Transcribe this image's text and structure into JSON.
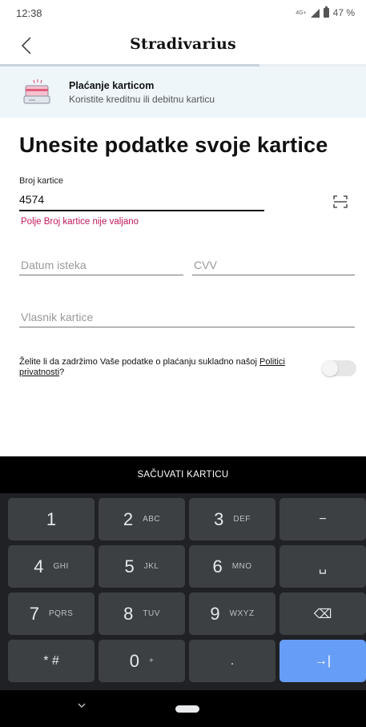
{
  "status_bar": {
    "time": "12:38",
    "network": "4G+",
    "battery": "47 %",
    "icons": [
      "network-type-icon",
      "signal-icon",
      "battery-icon"
    ]
  },
  "header": {
    "brand": "Stradivarius",
    "back_icon": "back-chevron-icon",
    "step_progress": 0.71
  },
  "payment_method": {
    "icon": "credit-card-icon",
    "title": "Plaćanje karticom",
    "subtitle": "Koristite kreditnu ili debitnu karticu"
  },
  "form": {
    "heading": "Unesite podatke svoje kartice",
    "card_number": {
      "label": "Broj kartice",
      "value": "4574",
      "error": "Polje Broj kartice nije valjano",
      "scan_icon": "scan-card-icon"
    },
    "expiry": {
      "placeholder": "Datum isteka",
      "value": ""
    },
    "cvv": {
      "placeholder": "CVV",
      "value": ""
    },
    "holder": {
      "placeholder": "Vlasnik kartice",
      "value": ""
    },
    "save_consent": {
      "text": "Želite li da zadržimo Vaše podatke o plaćanju sukladno našoj ",
      "link": "Politici privatnosti",
      "suffix": "?",
      "toggle_on": false
    }
  },
  "save_button": "SAČUVATI KARTICU",
  "keyboard": {
    "keys": [
      {
        "main": "1",
        "sub": ""
      },
      {
        "main": "2",
        "sub": "ABC"
      },
      {
        "main": "3",
        "sub": "DEF"
      },
      {
        "main": "−",
        "sub": ""
      },
      {
        "main": "4",
        "sub": "GHI"
      },
      {
        "main": "5",
        "sub": "JKL"
      },
      {
        "main": "6",
        "sub": "MNO"
      },
      {
        "main": "␣",
        "sub": ""
      },
      {
        "main": "7",
        "sub": "PQRS"
      },
      {
        "main": "8",
        "sub": "TUV"
      },
      {
        "main": "9",
        "sub": "WXYZ"
      },
      {
        "main": "⌫",
        "sub": ""
      },
      {
        "main": "* #",
        "sub": ""
      },
      {
        "main": "0",
        "sub": "+"
      },
      {
        "main": ".",
        "sub": ""
      },
      {
        "main": "→|",
        "sub": ""
      }
    ],
    "accent_color": "#669df6"
  },
  "nav_bar": {
    "icons": [
      "hide-keyboard-chevron-icon",
      "home-pill-icon"
    ]
  }
}
